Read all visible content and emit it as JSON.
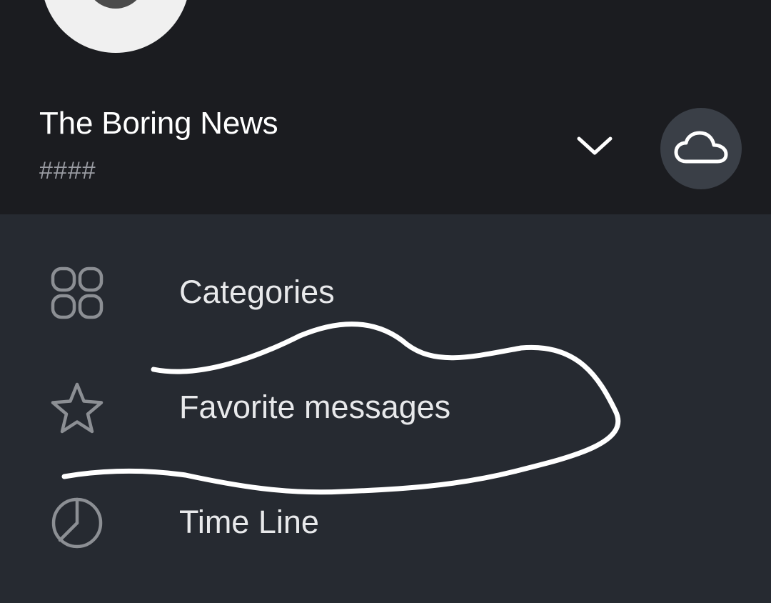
{
  "header": {
    "account_name": "The Boring News",
    "account_sub": "####",
    "expand_icon": "chevron-down-icon",
    "cloud_icon": "cloud-icon"
  },
  "menu": {
    "items": [
      {
        "label": "Categories",
        "icon": "grid-icon"
      },
      {
        "label": "Favorite messages",
        "icon": "star-icon"
      },
      {
        "label": "Time Line",
        "icon": "pie-chart-icon"
      }
    ]
  },
  "colors": {
    "header_bg": "#1b1c20",
    "menu_bg": "#262a31",
    "icon_gray": "#8c8f94",
    "text": "#e8e9eb",
    "cloud_button_bg": "#3a3f47"
  }
}
